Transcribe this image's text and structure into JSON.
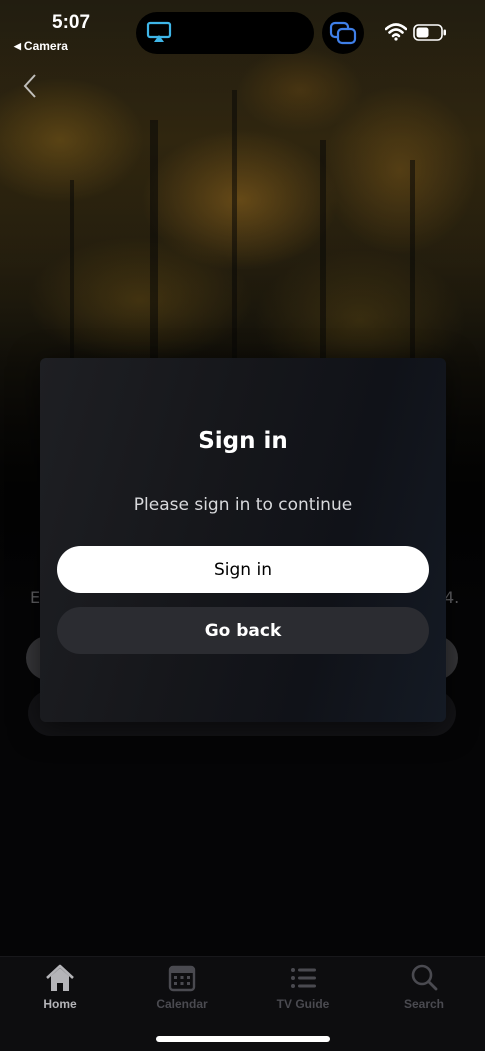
{
  "status_bar": {
    "time": "5:07",
    "back_app": "Camera",
    "back_arrow": "◀"
  },
  "icons": {
    "back": "chevron-left-icon",
    "airplay": "airplay-icon",
    "screen_mirror": "screen-mirroring-icon",
    "wifi": "wifi-icon",
    "battery": "battery-icon"
  },
  "background_page": {
    "text_left_fragment": "E",
    "text_right_fragment": "4."
  },
  "modal": {
    "title": "Sign in",
    "subtitle": "Please sign in to continue",
    "primary_button": "Sign in",
    "secondary_button": "Go back"
  },
  "tab_bar": {
    "tabs": [
      {
        "label": "Home",
        "icon": "home-icon",
        "active": true
      },
      {
        "label": "Calendar",
        "icon": "calendar-icon",
        "active": false
      },
      {
        "label": "TV Guide",
        "icon": "list-icon",
        "active": false
      },
      {
        "label": "Search",
        "icon": "search-icon",
        "active": false
      }
    ]
  },
  "colors": {
    "primary_button_bg": "#ffffff",
    "secondary_button_bg": "#2b2c31",
    "airplay_accent": "#3fb6e8",
    "active_tab": "#b4b4b8",
    "inactive_tab": "#4a4a50"
  }
}
